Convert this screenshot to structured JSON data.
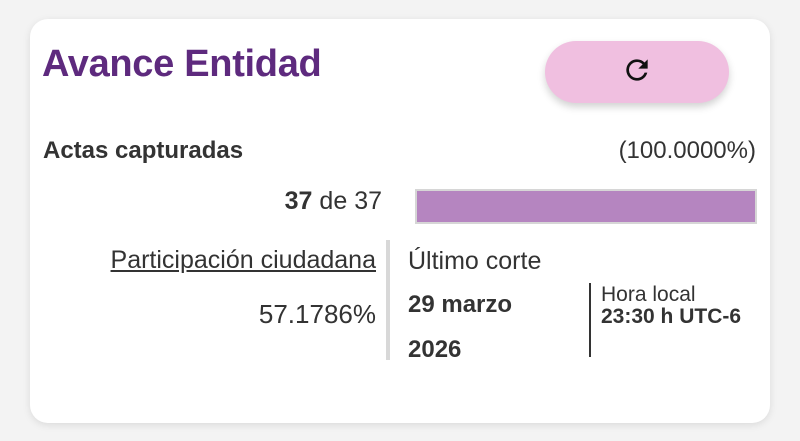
{
  "card": {
    "title": "Avance Entidad",
    "refresh_icon": "refresh-icon"
  },
  "actas": {
    "label": "Actas capturadas",
    "percent_text": "(100.0000%)",
    "captured": "37",
    "connector": "de",
    "total": "37",
    "progress_fraction": 1.0,
    "bar_color": "#b585c0"
  },
  "participacion": {
    "label": "Participación ciudadana",
    "value": "57.1786%"
  },
  "corte": {
    "label": "Último corte",
    "date": "29 marzo 2026",
    "hora_label": "Hora local",
    "hora_value": "23:30 h UTC-6"
  },
  "colors": {
    "title": "#5e2a7e",
    "button_bg": "#f0bfe0"
  }
}
